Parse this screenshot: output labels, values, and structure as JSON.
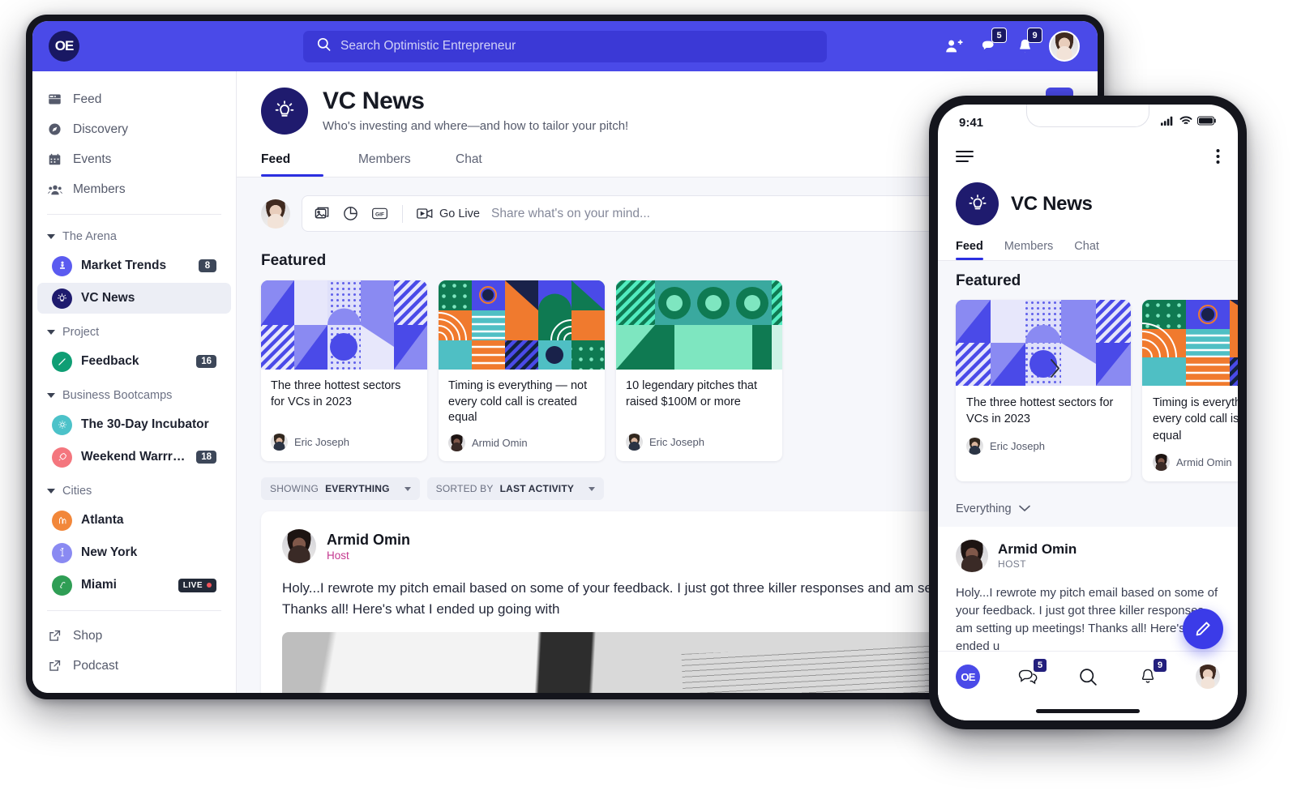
{
  "desktop": {
    "topbar": {
      "logo_text": "OE",
      "search_placeholder": "Search Optimistic Entrepreneur",
      "search_value": "",
      "invite_icon": "add-person-icon",
      "messages_icon": "chat-bubbles-icon",
      "messages_badge": "5",
      "notifications_icon": "bell-icon",
      "notifications_badge": "9",
      "avatar_label": "user-avatar"
    },
    "sidebar": {
      "main_items": [
        {
          "label": "Feed",
          "icon": "feed-icon"
        },
        {
          "label": "Discovery",
          "icon": "compass-icon"
        },
        {
          "label": "Events",
          "icon": "calendar-icon"
        },
        {
          "label": "Members",
          "icon": "people-icon"
        }
      ],
      "groups": [
        {
          "title": "The Arena",
          "channels": [
            {
              "label": "Market Trends",
              "badge": "8",
              "icon": "chess-piece-icon",
              "color": "#5b5bf0",
              "active": false
            },
            {
              "label": "VC News",
              "badge": "",
              "icon": "lightbulb-icon",
              "color": "#1f1b6e",
              "active": true
            }
          ]
        },
        {
          "title": "Project",
          "channels": [
            {
              "label": "Feedback",
              "badge": "16",
              "icon": "pencil-icon",
              "color": "#0f9e74",
              "active": false
            }
          ]
        },
        {
          "title": "Business Bootcamps",
          "channels": [
            {
              "label": "The 30-Day Incubator",
              "badge": "",
              "icon": "gear-icon",
              "color": "#4cc2c9",
              "active": false
            },
            {
              "label": "Weekend Warrrior",
              "badge": "18",
              "icon": "rocket-icon",
              "color": "#f4767e",
              "active": false
            }
          ]
        },
        {
          "title": "Cities",
          "channels": [
            {
              "label": "Atlanta",
              "badge": "",
              "icon": "city-icon",
              "color": "#f2873a",
              "active": false
            },
            {
              "label": "New York",
              "badge": "",
              "icon": "statue-of-liberty-icon",
              "color": "#8a8af2",
              "active": false
            },
            {
              "label": "Miami",
              "badge": "LIVE",
              "icon": "flamingo-icon",
              "color": "#2f9e55",
              "active": false
            }
          ]
        }
      ],
      "footer_items": [
        {
          "label": "Shop",
          "icon": "external-link-icon"
        },
        {
          "label": "Podcast",
          "icon": "external-link-icon"
        }
      ]
    },
    "group_header": {
      "avatar_icon": "lightbulb-icon",
      "title": "VC News",
      "subtitle": "Who's investing and where—and how to tailor your pitch!",
      "add_button": "+",
      "tabs": [
        {
          "label": "Feed",
          "active": true
        },
        {
          "label": "Members",
          "active": false
        },
        {
          "label": "Chat",
          "active": false
        }
      ]
    },
    "composer": {
      "placeholder": "Share what's on your mind...",
      "value": "",
      "golive_label": "Go Live",
      "icons": [
        "image-icon",
        "poll-icon",
        "gif-icon",
        "go-live-icon",
        "emoji-icon"
      ]
    },
    "featured": {
      "heading": "Featured",
      "cards": [
        {
          "title": "The three hottest sectors for VCs in 2023",
          "author": "Eric Joseph",
          "art": "blue-geometric"
        },
        {
          "title": "Timing is everything — not every cold call is created equal",
          "author": "Armid Omin",
          "art": "multicolor-geometric"
        },
        {
          "title": "10 legendary pitches that raised $100M or more",
          "author": "Eric Joseph",
          "art": "teal-geometric"
        }
      ],
      "next_icon": "chevron-right-icon"
    },
    "filters": {
      "showing_label": "SHOWING",
      "showing_value": "EVERYTHING",
      "sorted_label": "SORTED BY",
      "sorted_value": "LAST ACTIVITY",
      "view_toggle_icon": "list-view-icon"
    },
    "post": {
      "author": "Armid Omin",
      "role": "Host",
      "text": "Holy...I rewrote my pitch email based on some of your feedback. I just got three killer responses and am setting up meetings! Thanks all! Here's what I ended up going with",
      "photo": "open-book-photo"
    }
  },
  "phone": {
    "status": {
      "time": "9:41",
      "signal_icon": "cellular-signal-icon",
      "wifi_icon": "wifi-icon",
      "battery_icon": "battery-icon"
    },
    "topnav": {
      "menu_icon": "hamburger-menu-icon",
      "more_icon": "more-vertical-icon"
    },
    "group": {
      "avatar_icon": "lightbulb-icon",
      "title": "VC News",
      "tabs": [
        {
          "label": "Feed",
          "active": true
        },
        {
          "label": "Members",
          "active": false
        },
        {
          "label": "Chat",
          "active": false
        }
      ]
    },
    "featured": {
      "heading": "Featured",
      "cards": [
        {
          "title": "The three hottest sectors for VCs in 2023",
          "author": "Eric Joseph",
          "art": "blue-geometric"
        },
        {
          "title": "Timing is everything — not every cold call is created equal",
          "author": "Armid Omin",
          "art": "multicolor-geometric"
        }
      ]
    },
    "filter": {
      "label": "Everything",
      "icon": "chevron-down-icon"
    },
    "post": {
      "author": "Armid Omin",
      "role": "HOST",
      "text": "Holy...I rewrote my pitch email based on some of your feedback. I just got three killer responses am setting up meetings! Thanks all! Here's w ended u"
    },
    "fab_icon": "compose-pencil-icon",
    "bottomnav": {
      "logo_text": "OE",
      "messages_icon": "chat-bubbles-icon",
      "messages_badge": "5",
      "search_icon": "search-icon",
      "notifications_icon": "bell-icon",
      "notifications_badge": "9",
      "avatar_label": "user-avatar"
    }
  },
  "colors": {
    "brand_blue": "#4a4ae8",
    "deep_navy": "#191863",
    "accent_underline": "#2b2fe0",
    "badge_slate": "#3d4759",
    "host_magenta": "#c4388f",
    "page_bg": "#f6f7fb"
  }
}
